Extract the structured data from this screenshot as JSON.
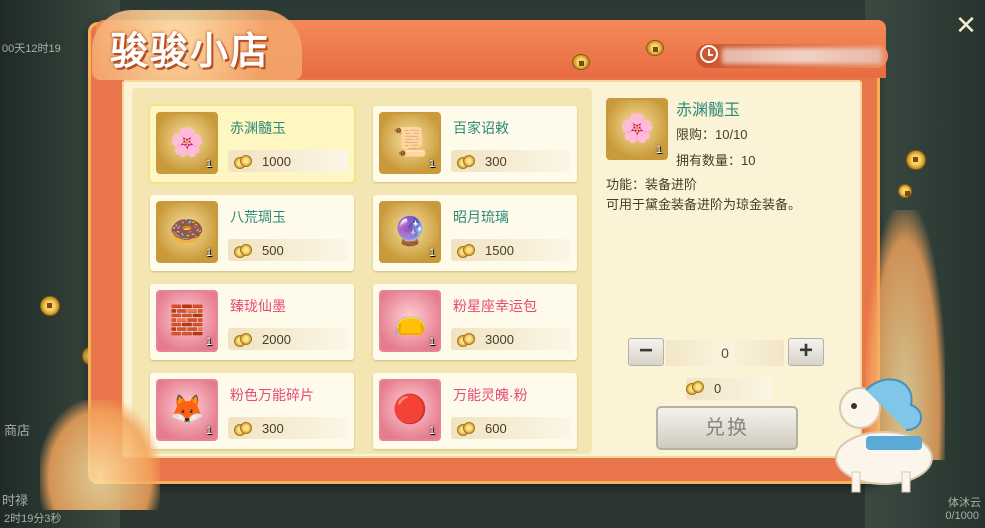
{
  "title": "骏骏小店",
  "background_texts": [
    "00天12时19",
    "商店",
    "时禄",
    "2时19分3秒",
    "0/1000",
    "体沐云"
  ],
  "items": [
    {
      "name": "赤渊髓玉",
      "price": "1000",
      "count": "1",
      "style": "gold",
      "glyph": "🌸",
      "selected": true
    },
    {
      "name": "百家诏敕",
      "price": "300",
      "count": "1",
      "style": "gold",
      "glyph": "📜"
    },
    {
      "name": "八荒琱玉",
      "price": "500",
      "count": "1",
      "style": "gold",
      "glyph": "🍩"
    },
    {
      "name": "昭月琉璃",
      "price": "1500",
      "count": "1",
      "style": "gold",
      "glyph": "🔮"
    },
    {
      "name": "臻珑仙墨",
      "price": "2000",
      "count": "1",
      "style": "pink",
      "glyph": "🧱"
    },
    {
      "name": "粉星座幸运包",
      "price": "3000",
      "count": "1",
      "style": "pink",
      "glyph": "👝"
    },
    {
      "name": "粉色万能碎片",
      "price": "300",
      "count": "1",
      "style": "pink",
      "glyph": "🦊"
    },
    {
      "name": "万能灵魄·粉",
      "price": "600",
      "count": "1",
      "style": "pink",
      "glyph": "🔴"
    }
  ],
  "detail": {
    "name": "赤渊髓玉",
    "count": "1",
    "glyph": "🌸",
    "limit": "限购：10/10",
    "owned": "拥有数量：10",
    "function": "功能：装备进阶",
    "description": "可用于黛金装备进阶为琼金装备。"
  },
  "stepper": {
    "minus": "−",
    "plus": "+",
    "value": "0"
  },
  "cost": "0",
  "exchange_label": "兑换",
  "close_label": "✕",
  "colors": {
    "accent": "#e9764a",
    "panel": "#fbf3d6",
    "green_text": "#2e8a78",
    "pink_text": "#e5497a"
  }
}
